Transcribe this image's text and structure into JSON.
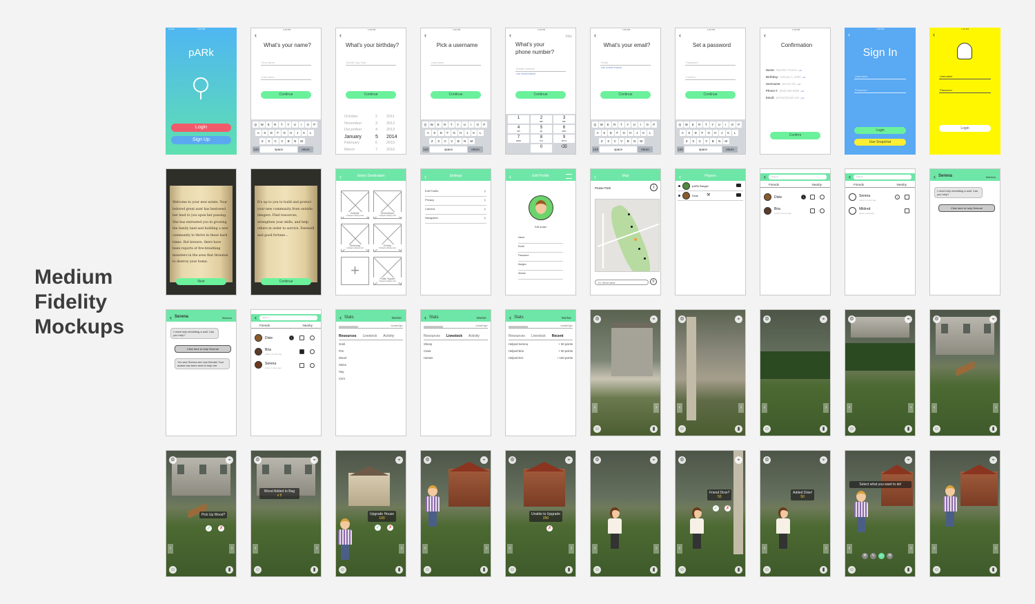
{
  "heading": [
    "Medium",
    "Fidelity",
    "Mockups"
  ],
  "status": {
    "carrier": "Carrier",
    "time": "1:20 PM",
    "battery": "100%"
  },
  "keyboard": {
    "row1": [
      "Q",
      "W",
      "E",
      "R",
      "T",
      "Y",
      "U",
      "I",
      "O",
      "P"
    ],
    "row2": [
      "A",
      "S",
      "D",
      "F",
      "G",
      "H",
      "J",
      "K",
      "L"
    ],
    "row3": [
      "Z",
      "X",
      "C",
      "V",
      "B",
      "N",
      "M"
    ],
    "num": "123",
    "space": "space",
    "return": "return"
  },
  "splash": {
    "title": "pARk",
    "login": "Login",
    "signup": "Sign Up"
  },
  "name_screen": {
    "q": "What's your name?",
    "ph1": "First name",
    "ph2": "Last name",
    "btn": "Continue"
  },
  "bday_screen": {
    "q": "What's your birthday?",
    "ph": "Month Day Year",
    "btn": "Continue",
    "months": [
      "October",
      "November",
      "December",
      "January",
      "February",
      "March"
    ],
    "days": [
      "2",
      "3",
      "4",
      "5",
      "6",
      "7"
    ],
    "years": [
      "2011",
      "2012",
      "2013",
      "2014",
      "2015",
      "2016"
    ]
  },
  "user_screen": {
    "q": "Pick a username",
    "ph": "Username",
    "btn": "Continue"
  },
  "phone_screen": {
    "q1": "What's your",
    "q2": "phone number?",
    "skip": "Skip",
    "ph": "Mobile Number",
    "hint": "Use email instead",
    "btn": "Continue",
    "keys": [
      [
        "1",
        ""
      ],
      [
        "2",
        "ABC"
      ],
      [
        "3",
        "DEF"
      ],
      [
        "4",
        "GHI"
      ],
      [
        "5",
        "JKL"
      ],
      [
        "6",
        "MNO"
      ],
      [
        "7",
        "PQRS"
      ],
      [
        "8",
        "TUV"
      ],
      [
        "9",
        "WXYZ"
      ],
      [
        "",
        ""
      ],
      [
        "0",
        ""
      ],
      [
        "⌫",
        ""
      ]
    ]
  },
  "email_screen": {
    "q": "What's your email?",
    "ph": "Email",
    "hint": "Use mobile instead",
    "btn": "Continue"
  },
  "pass_screen": {
    "q": "Set a password",
    "ph1": "Password",
    "ph2": "Confirm",
    "btn": "Continue"
  },
  "confirm_screen": {
    "title": "Confirmation",
    "fields": [
      {
        "k": "Name:",
        "v": "Random Person"
      },
      {
        "k": "Birthday:",
        "v": "January 1, 2000"
      },
      {
        "k": "Username:",
        "v": "person.me"
      },
      {
        "k": "Phone #:",
        "v": "(555) 555-5555"
      },
      {
        "k": "Email:",
        "v": "person@mail.com"
      }
    ],
    "edit": "edit",
    "btn": "Confirm"
  },
  "signin_screen": {
    "title": "Sign In",
    "ph1": "Username",
    "ph2": "Password",
    "btn1": "Login",
    "btn2": "Use Snapchat"
  },
  "snap_screen": {
    "ph1": "Username",
    "ph2": "Password",
    "btn": "Login"
  },
  "story1": {
    "text": "Welcome to your new estate. Your beloved great aunt has bestowed her land to you upon her passing. She has entrusted you in growing the family land and building a new community to thrive in these hard times. But beware, there have been reports of fire-breathing monsters in the area that threaten to destroy your home.",
    "btn": "Next"
  },
  "story2": {
    "text": "It's up to you to build and protect your new community from outside dangers. Find resources, strengthen your skills, and help others in order to survive. Farewell and good fortune...",
    "btn": "Continue"
  },
  "dest_screen": {
    "title": "Select Destination",
    "items": [
      {
        "n": "Brikville",
        "s": "3 players playing now"
      },
      {
        "n": "Serenaltown",
        "s": "1 players playing now"
      },
      {
        "n": "Dixieburg",
        "s": "2 players playing now"
      },
      {
        "n": "Emzity",
        "s": "5 players playing now"
      },
      {
        "n": "Public Square",
        "s": "3 players playing now"
      }
    ],
    "add": "+"
  },
  "settings_screen": {
    "title": "Settings",
    "items": [
      "Edit Profile",
      "Privacy",
      "Camera",
      "Navigation"
    ]
  },
  "profile_screen": {
    "title": "Edit Profile",
    "edit": "Edit avatar",
    "fields": [
      "Name",
      "Email",
      "Password",
      "Badges",
      "Worlds"
    ]
  },
  "map_screen": {
    "title": "Map",
    "place": "Pease Park",
    "search": "Ex. friend name"
  },
  "players_screen": {
    "title": "Players",
    "p1": "pARk Ranger",
    "p2": "Dixie"
  },
  "friends_screen": {
    "search": "Search",
    "tab1": "Friends",
    "tab2": "Nearby",
    "p1": "Dixie",
    "p2": "Bria",
    "p2s": "Active 3 hours ago"
  },
  "friends2_screen": {
    "search": "Search",
    "tab1": "Friends",
    "tab2": "Nearby",
    "p1": "Serena",
    "p1s": "Active 1 hours ago",
    "p2": "Mildred",
    "p2s": "Active yesterday"
  },
  "chat_screen": {
    "name": "Serena",
    "role": "Warlock",
    "msg": "I need help rebuilding a wall. Can you help?",
    "btn": "Click here to help Serena!"
  },
  "chat2_screen": {
    "name": "Serena",
    "role": "Warlock",
    "msg": "I need help rebuilding a wall. Can you help?",
    "btn": "Click here to help Serena!",
    "msg2": "You and Serena are now friends! Your avatar has been sent to help her."
  },
  "friends3_screen": {
    "search": "Search",
    "tab1": "Friends",
    "tab2": "Nearby",
    "p1": "Dixie",
    "p2": "Bria",
    "p2s": "Active 3 hours ago",
    "p3": "Serena",
    "p3s": "Active 1 days ago"
  },
  "stats1": {
    "title": "Stats",
    "role": "Worker",
    "lvl": "<Level Up>",
    "tabs": [
      "Resources",
      "Livestock",
      "Activity"
    ],
    "items": [
      "Gold",
      "Fire",
      "Wood",
      "Stone",
      "Hay",
      "Corn"
    ]
  },
  "stats2": {
    "title": "Stats",
    "role": "Worker",
    "lvl": "<Level Up>",
    "tabs": [
      "Resources",
      "Livestock",
      "Activity"
    ],
    "items": [
      "Sheep",
      "Cows",
      "Horses"
    ]
  },
  "stats3": {
    "title": "Stats",
    "role": "Worker",
    "lvl": "<Level Up>",
    "tabs": [
      "Resources",
      "Livestock",
      "Recent"
    ],
    "items": [
      "Helped Serena",
      "Helped Bria",
      "Helped Eric"
    ],
    "pts": [
      "+ 50 points",
      "+ 50 points",
      "+ 100 points"
    ]
  },
  "ar": {
    "pickup": "Pick Up Wood?",
    "added": "Wood Added to Bag",
    "added_count": "x 5",
    "upgrade": "Upgrade House",
    "upgrade_cost": "100",
    "unable": "Unable to Upgrade",
    "unable_cost": "250",
    "friend": "Friend Dixie?",
    "friend_cost": "50",
    "added_dixie": "Added Dixie!",
    "added_dixie_cost": "50",
    "select": "Select what you want to do!"
  },
  "colors": {
    "green": "#6bf19c",
    "teal": "#6ee6a7",
    "blue": "#59a9f3",
    "yellow": "#ffff00",
    "red": "#f05a6a"
  }
}
